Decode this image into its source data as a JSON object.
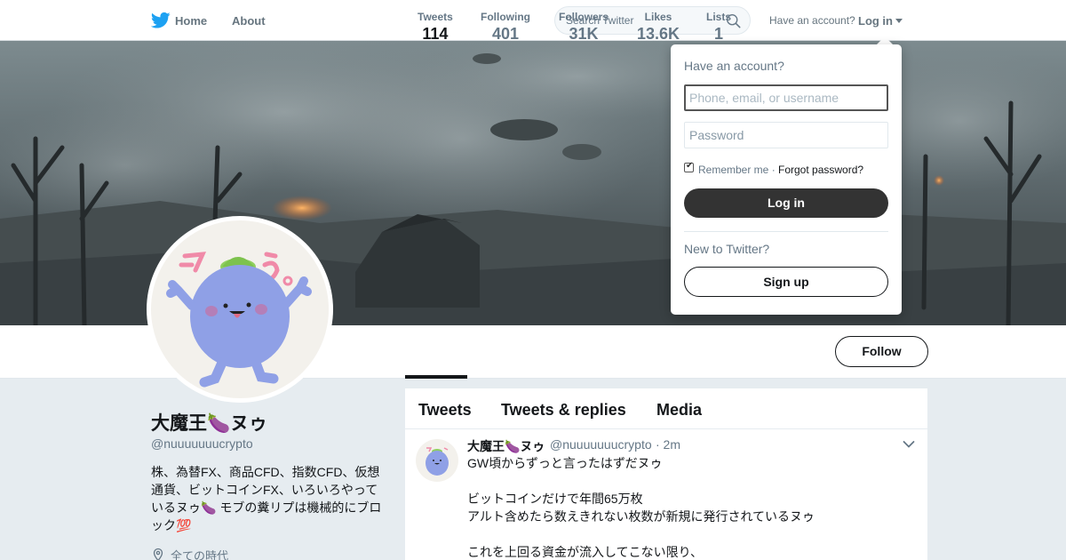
{
  "topnav": {
    "home_label": "Home",
    "about_label": "About",
    "search_placeholder": "Search Twitter",
    "account_prompt": "Have an account?",
    "login_label": "Log in"
  },
  "profile": {
    "name": "大魔王🍆ヌゥ",
    "handle": "@nuuuuuuucrypto",
    "bio": "株、為替FX、商品CFD、指数CFD、仮想通貨、ビットコインFX、いろいろやっているヌゥ🍆 モブの糞リプは機械的にブロック💯",
    "location": "全ての時代"
  },
  "stats": [
    {
      "label": "Tweets",
      "value": "114"
    },
    {
      "label": "Following",
      "value": "401"
    },
    {
      "label": "Followers",
      "value": "31K"
    },
    {
      "label": "Likes",
      "value": "13.6K"
    },
    {
      "label": "Lists",
      "value": "1"
    }
  ],
  "follow_label": "Follow",
  "timeline": {
    "tabs": [
      "Tweets",
      "Tweets & replies",
      "Media"
    ],
    "tweet": {
      "name": "大魔王🍆ヌゥ",
      "handle": "@nuuuuuuucrypto",
      "time": "· 2m",
      "lines": [
        "GW頃からずっと言ったはずだヌゥ",
        "",
        "ビットコインだけで年間65万枚",
        "アルト含めたら数えきれない枚数が新規に発行されているヌゥ",
        "",
        "これを上回る資金が流入してこない限り、"
      ]
    }
  },
  "login_dropdown": {
    "title": "Have an account?",
    "username_placeholder": "Phone, email, or username",
    "password_placeholder": "Password",
    "remember_label": "Remember me ·",
    "forgot_label": "Forgot password?",
    "login_button": "Log in",
    "new_prompt": "New to Twitter?",
    "signup_button": "Sign up"
  },
  "colors": {
    "brand_blue": "#1da1f2",
    "button_dark": "#333333"
  }
}
